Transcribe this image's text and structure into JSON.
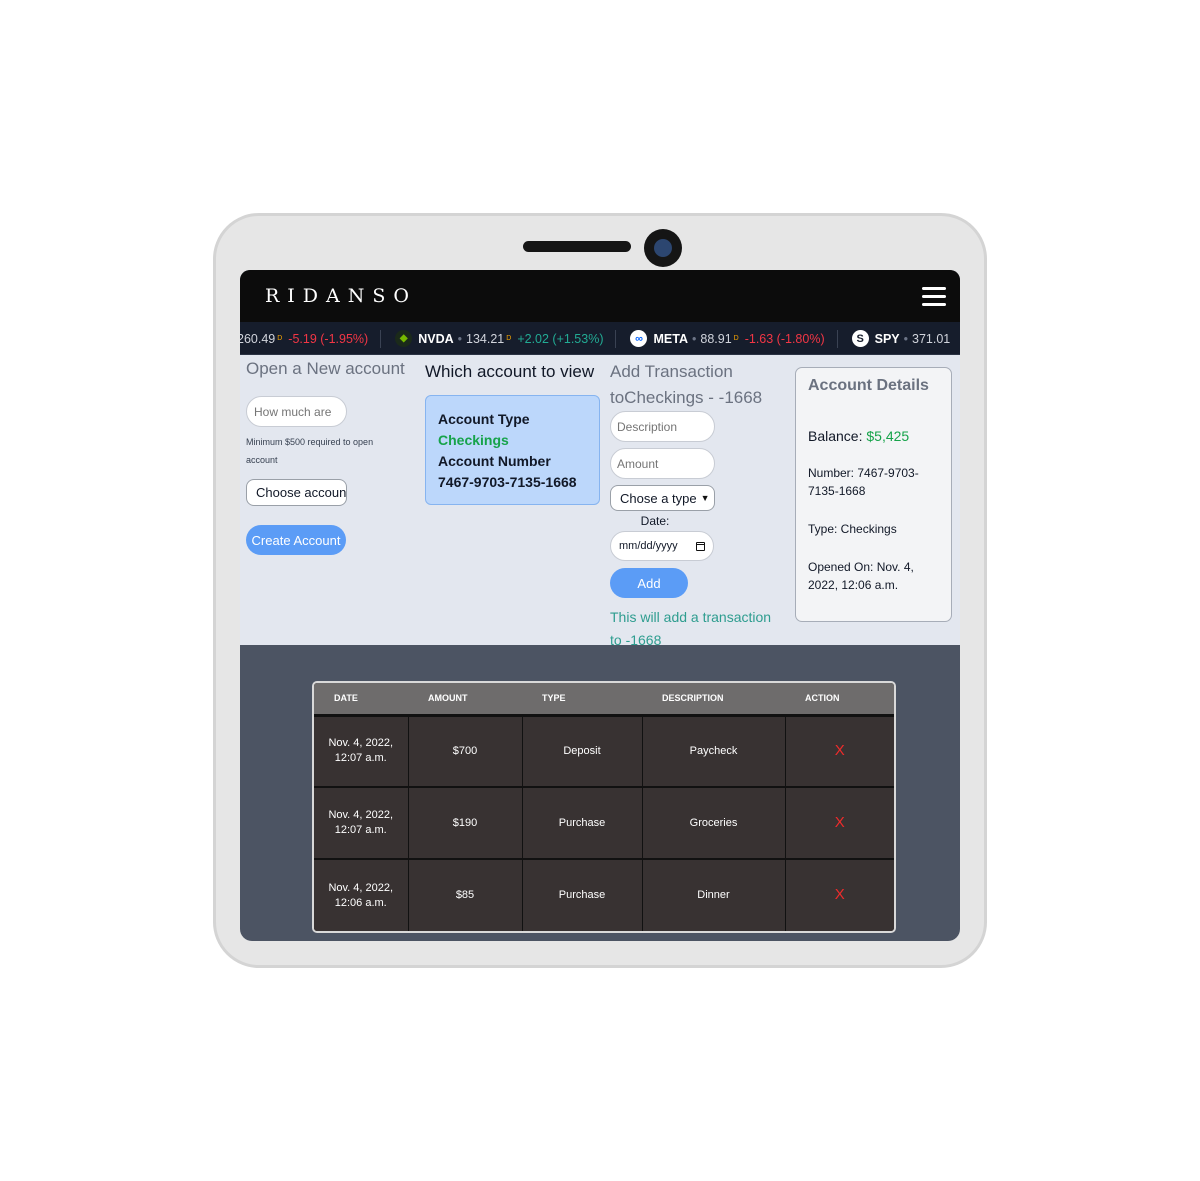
{
  "navbar": {
    "brand": "RIDANSO",
    "menu_icon": "hamburger-icon"
  },
  "ticker": [
    {
      "symbol": "",
      "price": "260.49",
      "change": "-5.19 (-1.95%)",
      "direction": "down"
    },
    {
      "symbol": "NVDA",
      "price": "134.21",
      "change": "+2.02 (+1.53%)",
      "direction": "up"
    },
    {
      "symbol": "META",
      "price": "88.91",
      "change": "-1.63 (-1.80%)",
      "direction": "down"
    },
    {
      "symbol": "SPY",
      "price": "371.01",
      "change": "",
      "direction": ""
    }
  ],
  "open_account": {
    "title": "Open a New account",
    "amount_placeholder": "How much are",
    "hint": "Minimum $500 required to open account",
    "select_value": "Choose account",
    "create_button": "Create Account"
  },
  "view_account": {
    "title": "Which account to view",
    "type_label": "Account Type",
    "type_value": "Checkings",
    "number_label": "Account Number 7467-9703-7135-1668"
  },
  "add_transaction": {
    "title": "Add Transaction toCheckings - -1668",
    "description_placeholder": "Description",
    "amount_placeholder": "Amount",
    "type_select": "Chose a type",
    "date_label": "Date:",
    "date_value": "mm/dd/yyyy",
    "add_button": "Add",
    "note": "This will add a transaction to -1668"
  },
  "account_details": {
    "title": "Account Details",
    "balance_label": "Balance:",
    "balance_value": "$5,425",
    "number": "Number: 7467-9703-7135-1668",
    "type": "Type: Checkings",
    "opened": "Opened On: Nov. 4, 2022, 12:06 a.m."
  },
  "transactions": {
    "columns": [
      "DATE",
      "AMOUNT",
      "TYPE",
      "DESCRIPTION",
      "ACTION"
    ],
    "rows": [
      {
        "date": "Nov. 4, 2022, 12:07 a.m.",
        "amount": "$700",
        "type": "Deposit",
        "description": "Paycheck",
        "action": "X"
      },
      {
        "date": "Nov. 4, 2022, 12:07 a.m.",
        "amount": "$190",
        "type": "Purchase",
        "description": "Groceries",
        "action": "X"
      },
      {
        "date": "Nov. 4, 2022, 12:06 a.m.",
        "amount": "$85",
        "type": "Purchase",
        "description": "Dinner",
        "action": "X"
      }
    ]
  },
  "colors": {
    "accent": "#5b9cf6",
    "positive": "#16a34a",
    "negative": "#ef2b2b",
    "navbar": "#0c0c0c"
  }
}
